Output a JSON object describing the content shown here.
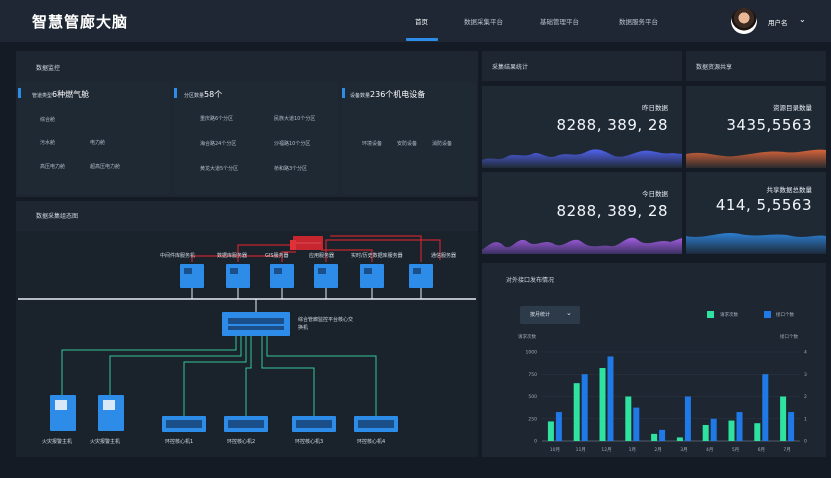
{
  "app_title": "智慧管廊大脑",
  "nav": [
    {
      "label": "首页",
      "active": true
    },
    {
      "label": "数据采集平台",
      "active": false
    },
    {
      "label": "基础管理平台",
      "active": false
    },
    {
      "label": "数据服务平台",
      "active": false
    }
  ],
  "user": {
    "name": "用户名",
    "caret": "⌄"
  },
  "monitor": {
    "title": "数据监控",
    "gas": {
      "prefix": "管道类型",
      "count": "6种燃气舱",
      "items": [
        "综合舱",
        "污水舱",
        "电力舱",
        "高压电力舱",
        "超高压电力舱"
      ]
    },
    "zones": {
      "prefix": "分区数量",
      "count": "58个",
      "items": [
        "重庆路6个分区",
        "民族大道10个分区",
        "海合路24个分区",
        "沙福路10个分区",
        "黄龙大道5个分区",
        "桥和路3个分区"
      ]
    },
    "devices": {
      "prefix": "设备数量",
      "count": "236个机电设备",
      "items": [
        "环境设备",
        "安防设备",
        "消防设备"
      ]
    }
  },
  "topology": {
    "title": "数据采集组态图",
    "servers": [
      "中间件库服务机",
      "数据库服务器",
      "GIS服务器",
      "应用服务器",
      "实时/历史数据库服务器",
      "通信服务器"
    ],
    "core_switch": "综合管廊监控平台核心交换机",
    "hosts": [
      "火灾报警主机",
      "火灾报警主机"
    ],
    "switches": [
      "环控核心机1",
      "环控核心机2",
      "环控核心机3",
      "环控核心机4"
    ]
  },
  "collection": {
    "title": "采集结果统计",
    "cards": [
      {
        "label": "昨日数据",
        "value": "8288, 389, 28",
        "color": "#4a5bdc"
      },
      {
        "label": "今日数据",
        "value": "8288, 389, 28",
        "color": "#8e5ad8"
      }
    ]
  },
  "resource": {
    "title": "数据资源共享",
    "cards": [
      {
        "label": "资源目录数量",
        "value": "3435,5563",
        "color": "#c9603a"
      },
      {
        "label": "共享数据总数量",
        "value": "414, 5,5563",
        "color": "#2a78c8"
      }
    ]
  },
  "interface": {
    "title": "对外接口发布情况",
    "dropdown": {
      "label": "按月统计",
      "caret": "⌄"
    },
    "legend": [
      {
        "name": "请求次数",
        "color": "#2ee3a0"
      },
      {
        "name": "接口个数",
        "color": "#1f7ae8"
      }
    ]
  },
  "chart_data": {
    "type": "bar",
    "categories": [
      "10月",
      "11月",
      "12月",
      "1月",
      "2月",
      "3月",
      "4月",
      "5月",
      "6月",
      "7月"
    ],
    "series": [
      {
        "name": "请求次数",
        "values": [
          220,
          650,
          820,
          500,
          80,
          40,
          180,
          230,
          200,
          500
        ]
      },
      {
        "name": "接口个数",
        "values": [
          1.3,
          3.0,
          3.8,
          1.5,
          0.5,
          2.0,
          1.0,
          1.3,
          3.0,
          1.3
        ]
      }
    ],
    "ylabel_left": "请求次数",
    "ylabel_right": "接口个数",
    "yticks_left": [
      "0",
      "250",
      "500",
      "750",
      "1000"
    ],
    "yticks_right": [
      "0",
      "1",
      "2",
      "3",
      "4"
    ],
    "ylim_left": [
      0,
      1000
    ],
    "ylim_right": [
      0,
      4
    ],
    "legend_position": "top-right"
  }
}
